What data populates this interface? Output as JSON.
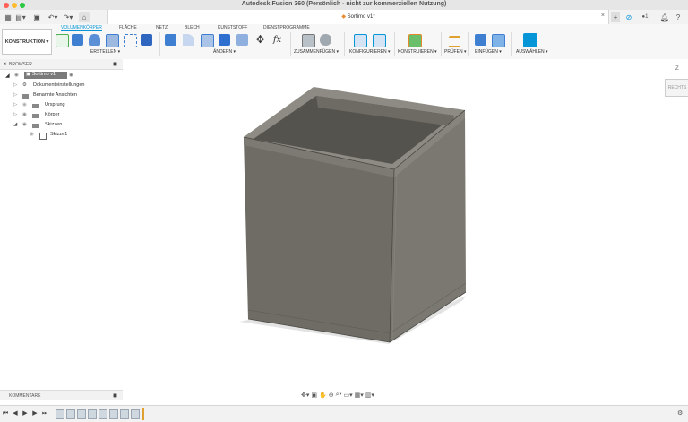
{
  "window": {
    "title": "Autodesk Fusion 360 (Persönlich - nicht zur kommerziellen Nutzung)"
  },
  "document_tab": {
    "label": "Sortimo v1*"
  },
  "workspace": {
    "label": "KONSTRUKTION ▾"
  },
  "toolbar_tabs": [
    "VOLUMENKÖRPER",
    "FLÄCHE",
    "NETZ",
    "BLECH",
    "KUNSTSTOFF",
    "DIENSTPROGRAMME"
  ],
  "tool_groups": {
    "erstellen": "ERSTELLEN ▾",
    "aendern": "ÄNDERN ▾",
    "zusammenfuegen": "ZUSAMMENFÜGEN ▾",
    "konfigurieren": "KONFIGURIEREN ▾",
    "konstruieren": "KONSTRUIEREN ▾",
    "pruefen": "PRÜFEN ▾",
    "einfuegen": "EINFÜGEN ▾",
    "auswaehlen": "AUSWÄHLEN ▾"
  },
  "right_status": {
    "user_count": "1"
  },
  "browser": {
    "header": "BROWSER",
    "root": "Sortimo v1",
    "items": [
      "Dokumenteinstellungen",
      "Benannte Ansichten",
      "Ursprung",
      "Körper",
      "Skizzen",
      "Skizze1"
    ]
  },
  "viewcube": {
    "face_label": "RECHTS",
    "axis_label": "Z"
  },
  "comments": {
    "label": "KOMMENTARE"
  },
  "colors": {
    "accent": "#0696d7",
    "body_front": "#6e6c64",
    "body_side": "#7a7870",
    "body_rim": "#8d8b83"
  }
}
